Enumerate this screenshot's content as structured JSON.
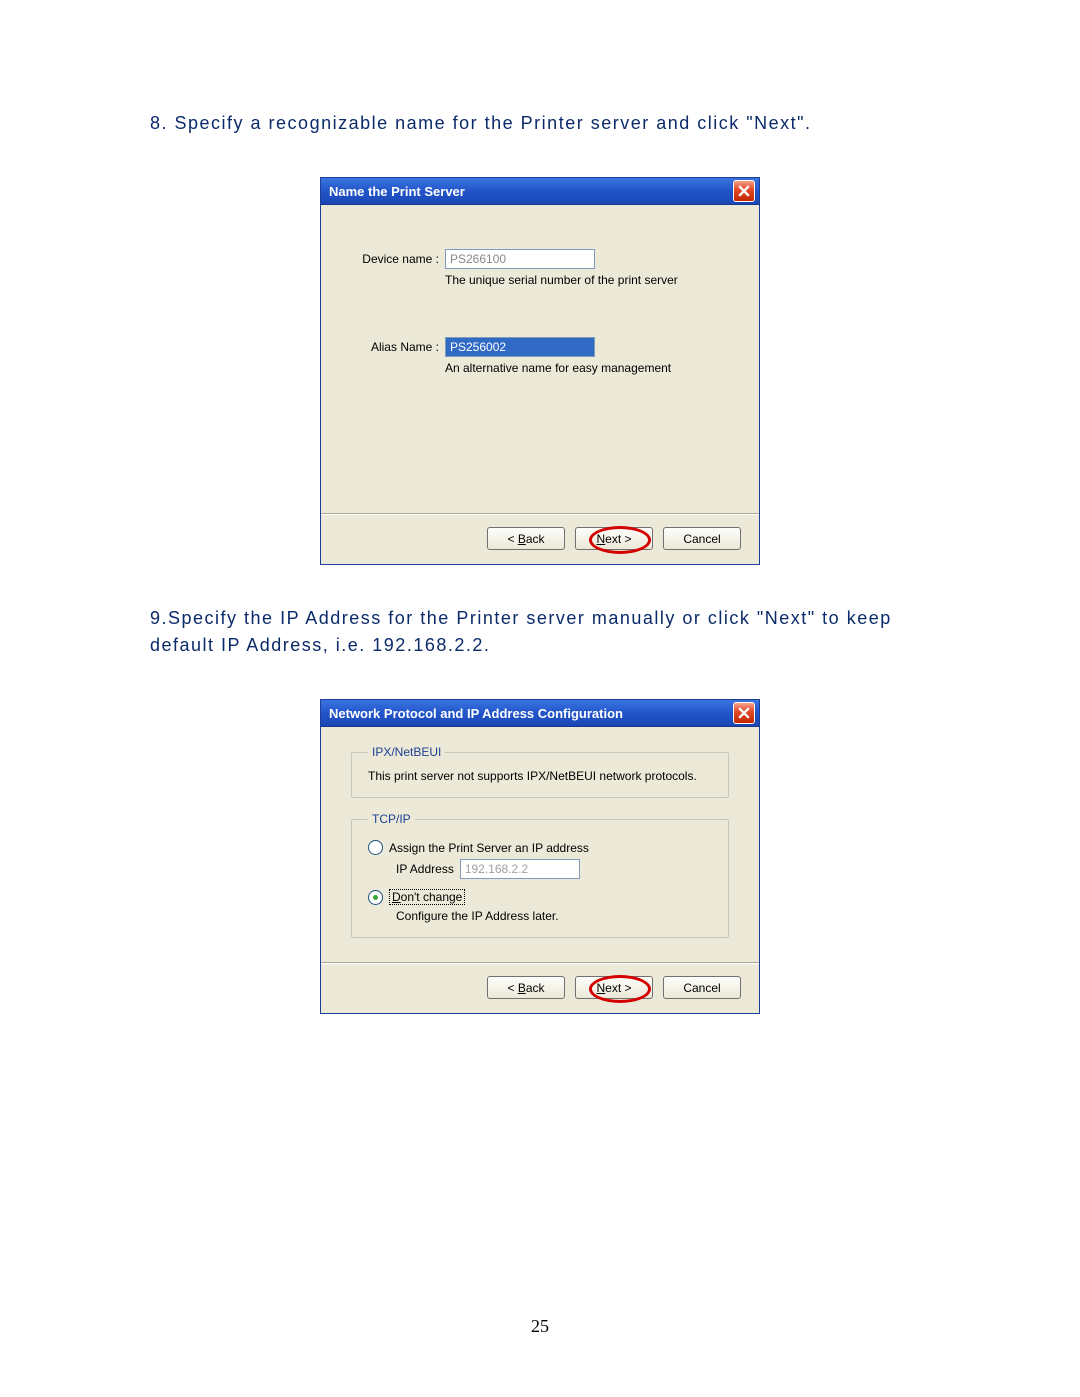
{
  "step8": {
    "text": "8.  Specify a recognizable name for the Printer server and click \"Next\"."
  },
  "step9": {
    "text": "9.Specify the IP Address for the Printer server manually or click \"Next\" to keep default IP Address, i.e. 192.168.2.2."
  },
  "dialog1": {
    "title": "Name the Print Server",
    "device_label": "Device name :",
    "device_value": "PS266100",
    "device_hint": "The unique serial number of the print server",
    "alias_label": "Alias Name :",
    "alias_value": "PS256002",
    "alias_hint": "An alternative name for easy management",
    "back": "< Back",
    "next": "Next >",
    "cancel": "Cancel"
  },
  "dialog2": {
    "title": "Network Protocol and IP Address Configuration",
    "group1": {
      "legend": "IPX/NetBEUI",
      "note": "This print server not supports IPX/NetBEUI network protocols."
    },
    "group2": {
      "legend": "TCP/IP",
      "opt_assign": "Assign the Print Server an IP address",
      "ip_label": "IP Address",
      "ip_value": "192.168.2.2",
      "opt_dont": "Don't change",
      "dont_note": "Configure the IP Address later."
    },
    "back": "< Back",
    "next": "Next >",
    "cancel": "Cancel"
  },
  "page_number": "25"
}
